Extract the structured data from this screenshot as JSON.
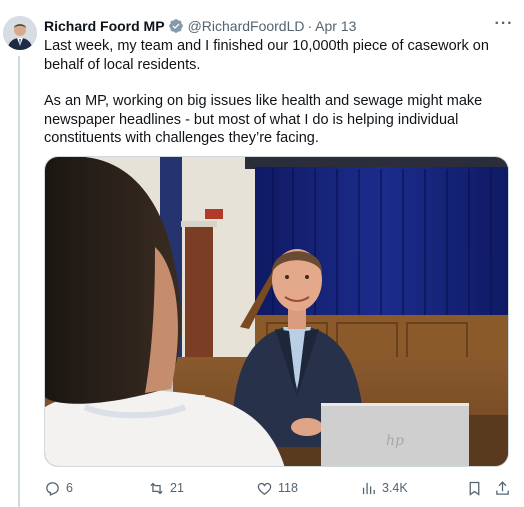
{
  "tweet": {
    "author_name": "Richard Foord MP",
    "handle": "@RichardFoordLD",
    "separator": "·",
    "date": "Apr 13",
    "more_label": "···",
    "paragraphs": [
      "Last week, my team and I finished our 10,000th piece of casework on behalf of local residents.",
      "As an MP, working on big issues like health and sewage might make newspaper headlines - but most of what I do is helping individual constituents with challenges they’re facing."
    ]
  },
  "actions": {
    "replies": "6",
    "reposts": "21",
    "likes": "118",
    "views": "3.4K"
  },
  "colors": {
    "text": "#0f1419",
    "secondary": "#536471",
    "verified": "#829aab",
    "thread_line": "#cfd9de"
  },
  "icons": [
    "verified-badge-icon",
    "more-icon",
    "reply-icon",
    "repost-icon",
    "like-icon",
    "views-icon",
    "bookmark-icon",
    "share-icon",
    "hp-logo"
  ]
}
